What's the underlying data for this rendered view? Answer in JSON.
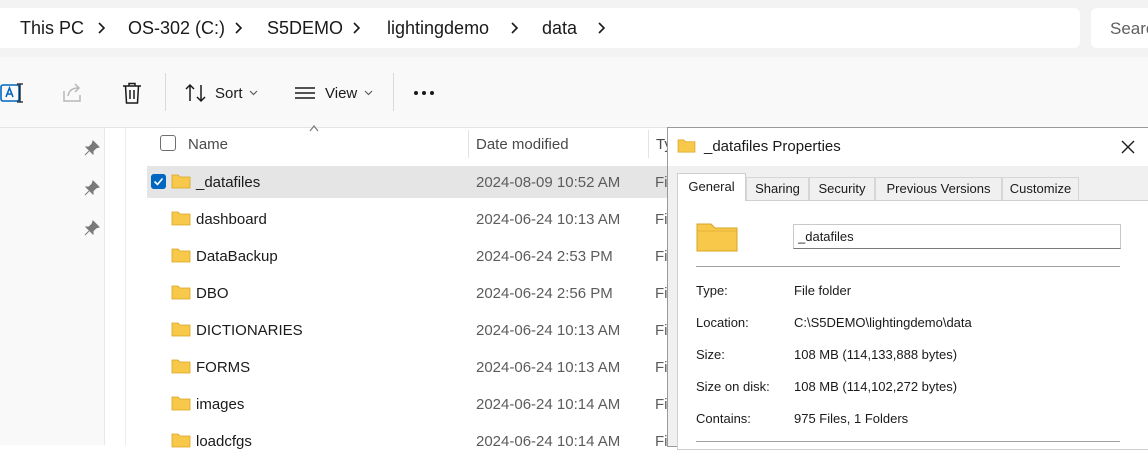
{
  "breadcrumb": [
    "This PC",
    "OS-302 (C:)",
    "S5DEMO",
    "lightingdemo",
    "data"
  ],
  "search": {
    "placeholder": "Search"
  },
  "toolbar": {
    "sort_label": "Sort",
    "view_label": "View"
  },
  "columns": {
    "name": "Name",
    "date": "Date modified",
    "type": "Ty"
  },
  "files": [
    {
      "name": "_datafiles",
      "date": "2024-08-09 10:52 AM",
      "type": "Fi",
      "selected": true
    },
    {
      "name": "dashboard",
      "date": "2024-06-24 10:13 AM",
      "type": "Fi"
    },
    {
      "name": "DataBackup",
      "date": "2024-06-24 2:53 PM",
      "type": "Fi"
    },
    {
      "name": "DBO",
      "date": "2024-06-24 2:56 PM",
      "type": "Fi"
    },
    {
      "name": "DICTIONARIES",
      "date": "2024-06-24 10:13 AM",
      "type": "Fi"
    },
    {
      "name": "FORMS",
      "date": "2024-06-24 10:13 AM",
      "type": "Fi"
    },
    {
      "name": "images",
      "date": "2024-06-24 10:14 AM",
      "type": "Fi"
    },
    {
      "name": "loadcfgs",
      "date": "2024-06-24 10:14 AM",
      "type": "Fi"
    }
  ],
  "dialog": {
    "title": "_datafiles Properties",
    "tabs": [
      "General",
      "Sharing",
      "Security",
      "Previous Versions",
      "Customize"
    ],
    "active_tab": "General",
    "folder_name": "_datafiles",
    "props": [
      {
        "label": "Type:",
        "value": "File folder"
      },
      {
        "label": "Location:",
        "value": "C:\\S5DEMO\\lightingdemo\\data"
      },
      {
        "label": "Size:",
        "value": "108 MB (114,133,888 bytes)"
      },
      {
        "label": "Size on disk:",
        "value": "108 MB (114,102,272 bytes)"
      },
      {
        "label": "Contains:",
        "value": "975 Files, 1 Folders"
      }
    ]
  },
  "colors": {
    "accent": "#0067c0",
    "folder": "#f8c84a",
    "selected_row": "#e5e5e5"
  }
}
